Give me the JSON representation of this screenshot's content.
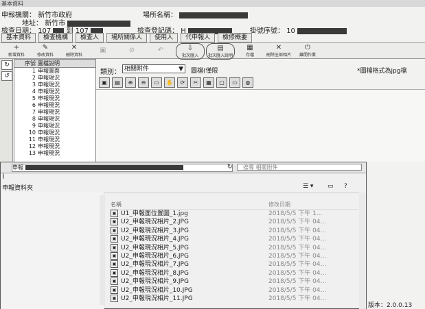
{
  "titlebar": "基本資料",
  "header": {
    "applicant_label": "申報機關：",
    "applicant_value": "新竹市政府",
    "site_name_label": "場所名稱：",
    "address_label": "地址：",
    "address_value": "新竹市",
    "inspect_date_label": "檢查日期：",
    "inspect_date_from": "107",
    "to_label": "到",
    "inspect_date_to": "107",
    "reg_no_label": "檢查登記碼：",
    "reg_no_value": "H",
    "receipt_label": "掛號序號：",
    "receipt_value": "10"
  },
  "tabs": [
    "基本資料",
    "檢查機構",
    "檢查人",
    "場所關係人",
    "使用人",
    "代申報人",
    "檢修概要"
  ],
  "toolbar": [
    {
      "label": "新增資料",
      "icon": "+"
    },
    {
      "label": "修改資料",
      "icon": "✎"
    },
    {
      "label": "刪除資料",
      "icon": "✕"
    },
    {
      "label": "",
      "icon": "▣"
    },
    {
      "label": "",
      "icon": "⊘"
    },
    {
      "label": "",
      "icon": "↶"
    },
    {
      "label": "批次匯入",
      "icon": "⇩"
    },
    {
      "label": "批次匯入說明",
      "icon": "▤"
    },
    {
      "label": "存檔",
      "icon": "▦"
    },
    {
      "label": "刪除全部相片",
      "icon": "✕"
    },
    {
      "label": "離開作業",
      "icon": "⏻"
    }
  ],
  "list": {
    "headers": [
      "序號",
      "圖檔說明"
    ],
    "rows": [
      {
        "num": "1",
        "text": "申報圖面"
      },
      {
        "num": "2",
        "text": "申報現況"
      },
      {
        "num": "3",
        "text": "申報現況"
      },
      {
        "num": "4",
        "text": "申報現況"
      },
      {
        "num": "5",
        "text": "申報現況"
      },
      {
        "num": "6",
        "text": "申報現況"
      },
      {
        "num": "7",
        "text": "申報現況"
      },
      {
        "num": "8",
        "text": "申報現況"
      },
      {
        "num": "9",
        "text": "申報現況"
      },
      {
        "num": "10",
        "text": "申報現況"
      },
      {
        "num": "11",
        "text": "申報現況"
      },
      {
        "num": "12",
        "text": "申報現況"
      },
      {
        "num": "13",
        "text": "申報現況"
      }
    ]
  },
  "rightpane": {
    "category_label": "類別：",
    "category_value": "相關附件",
    "filter_text": "圖檔(僅限",
    "format_note": "*圖檔格式為jpg檔"
  },
  "dialog": {
    "address_prefix": "申報",
    "search_placeholder": "搜尋 相關附件",
    "organize_label": "申報資料夾",
    "columns": [
      "名稱",
      "修改日期"
    ],
    "files": [
      {
        "name": "U1_申報面位置圖_1.jpg",
        "date": "2018/5/5 下午 1..."
      },
      {
        "name": "U2_申報現況相片_2.JPG",
        "date": "2018/5/5 下午 04..."
      },
      {
        "name": "U2_申報現況相片_3.JPG",
        "date": "2018/5/5 下午 04..."
      },
      {
        "name": "U2_申報現況相片_4.JPG",
        "date": "2018/5/5 下午 04..."
      },
      {
        "name": "U2_申報現況相片_5.JPG",
        "date": "2018/5/5 下午 04..."
      },
      {
        "name": "U2_申報現況相片_6.JPG",
        "date": "2018/5/5 下午 04..."
      },
      {
        "name": "U2_申報現況相片_7.JPG",
        "date": "2018/5/5 下午 04..."
      },
      {
        "name": "U2_申報現況相片_8.JPG",
        "date": "2018/5/5 下午 04..."
      },
      {
        "name": "U2_申報現況相片_9.JPG",
        "date": "2018/5/5 下午 04..."
      },
      {
        "name": "U2_申報現況相片_10.JPG",
        "date": "2018/5/5 下午 04..."
      },
      {
        "name": "U2_申報現況相片_11.JPG",
        "date": "2018/5/5 下午 04..."
      }
    ]
  },
  "version": "版本：2.0.0.13"
}
